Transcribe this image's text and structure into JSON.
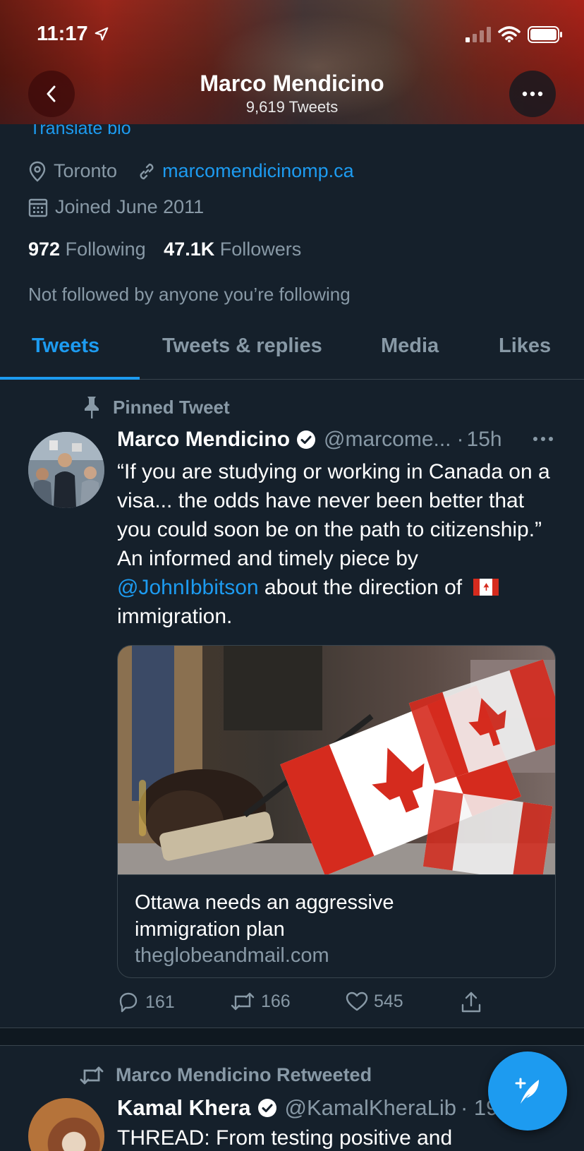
{
  "status_bar": {
    "time": "11:17"
  },
  "header": {
    "title": "Marco Mendicino",
    "subtitle": "9,619 Tweets"
  },
  "profile": {
    "translate_bio": "Translate bio",
    "location": "Toronto",
    "website": "marcomendicinomp.ca",
    "joined": "Joined June 2011",
    "following_count": "972",
    "following_label": "Following",
    "followers_count": "47.1K",
    "followers_label": "Followers",
    "not_followed": "Not followed by anyone you’re following"
  },
  "tabs": [
    {
      "label": "Tweets",
      "active": true
    },
    {
      "label": "Tweets & replies",
      "active": false
    },
    {
      "label": "Media",
      "active": false
    },
    {
      "label": "Likes",
      "active": false
    }
  ],
  "pinned_tweet": {
    "pin_label": "Pinned Tweet",
    "author": "Marco Mendicino",
    "handle": "@marcome...",
    "dot": "·",
    "time": "15h",
    "text_part1": "“If you are studying or working in Canada on a visa... the odds have never been better that you could soon be on the path to citizenship.” An informed and timely piece by ",
    "mention": "@JohnIbbitson",
    "text_part2": " about the direction of ",
    "flag": "🇨🇦",
    "text_part3": " immigration.",
    "card": {
      "title": "Ottawa needs an aggressive immigration plan",
      "domain": "theglobeandmail.com"
    },
    "replies": "161",
    "retweets": "166",
    "likes": "545"
  },
  "retweet": {
    "label": "Marco Mendicino Retweeted",
    "author": "Kamal Khera",
    "handle": "@KamalKheraLib",
    "time_partial": "· 19",
    "text": "THREAD: From testing positive and"
  },
  "colors": {
    "background": "#15202b",
    "accent": "#1d9bf0",
    "secondary_text": "#8899a6",
    "border": "#38444d"
  }
}
